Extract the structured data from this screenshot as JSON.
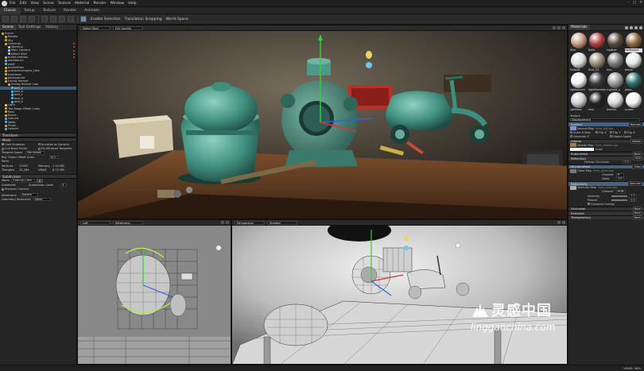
{
  "menubar": {
    "items": [
      "File",
      "Edit",
      "View",
      "Scene",
      "Texture",
      "Material",
      "Render",
      "Window",
      "Help"
    ]
  },
  "mode_tabs": [
    "Classic",
    "Setup",
    "Texture",
    "Render",
    "Animate"
  ],
  "toolbar": {
    "enable_selection": "Enable Selection",
    "translation_snapping": "Translation Snapping",
    "world_space": "World Space"
  },
  "left_panel": {
    "tabs": [
      "Scene",
      "Tool Settings",
      "History"
    ],
    "tree": [
      {
        "label": "Scene",
        "indent": 0,
        "icon": "scene"
      },
      {
        "label": "Render",
        "indent": 1,
        "icon": "folder"
      },
      {
        "label": "Sky",
        "indent": 1,
        "icon": "folder"
      },
      {
        "label": "Cameras",
        "indent": 1,
        "icon": "folder"
      },
      {
        "label": "Working",
        "indent": 2,
        "icon": "camera"
      },
      {
        "label": "Main Camera",
        "indent": 2,
        "icon": "camera"
      },
      {
        "label": "Detail Shot",
        "indent": 2,
        "icon": "camera"
      },
      {
        "label": "bullet prefabs",
        "indent": 1,
        "icon": "folder"
      },
      {
        "label": "workbench",
        "indent": 1,
        "icon": "mesh"
      },
      {
        "label": "shelf",
        "indent": 1,
        "icon": "mesh"
      },
      {
        "label": "bucketFiles",
        "indent": 1,
        "icon": "folder"
      },
      {
        "label": "screwdrivemptor_tiles",
        "indent": 1,
        "icon": "folder"
      },
      {
        "label": "toolcases",
        "indent": 1,
        "icon": "folder"
      },
      {
        "label": "background",
        "indent": 1,
        "icon": "folder"
      },
      {
        "label": "Diving Helmet",
        "indent": 1,
        "icon": "folder"
      },
      {
        "label": "Diving Helmet Low",
        "indent": 2,
        "icon": "folder"
      },
      {
        "label": "bolt_a",
        "indent": 3,
        "icon": "mesh"
      },
      {
        "label": "bolt_b",
        "indent": 3,
        "icon": "mesh"
      },
      {
        "label": "bolt_c",
        "indent": 3,
        "icon": "mesh"
      },
      {
        "label": "bolt_d",
        "indent": 3,
        "icon": "mesh"
      },
      {
        "label": "bolt_e",
        "indent": 3,
        "icon": "mesh"
      },
      {
        "label": "Light",
        "indent": 1,
        "icon": "light"
      },
      {
        "label": "Top Stage Offset Lines",
        "indent": 1,
        "icon": "folder"
      },
      {
        "label": "Rear",
        "indent": 1,
        "icon": "folder"
      },
      {
        "label": "Boxes",
        "indent": 1,
        "icon": "folder"
      },
      {
        "label": "Ground",
        "indent": 1,
        "icon": "mesh"
      },
      {
        "label": "Walls",
        "indent": 1,
        "icon": "mesh"
      },
      {
        "label": "Props",
        "indent": 1,
        "icon": "folder"
      },
      {
        "label": "Helmet",
        "indent": 1,
        "icon": "mesh"
      }
    ],
    "transform_section": "Transform",
    "mesh_section": "Mesh",
    "cast_shadows": "Cast Shadows",
    "invisible_to_camera": "Invisible to Camera",
    "cull_back_faces": "Cull Back Faces",
    "fix_mirrored_tangents": "Fix Mirrored Tangents",
    "tangent_space": "Tangent Space",
    "tangent_space_value": "Marmoset",
    "ray_origin_offset": "Ray Origin Offset (mm)",
    "ray_origin_value": "0.0",
    "parts_label": "Parts",
    "vertices_label": "Vertices",
    "vertices_value": "12597",
    "triangles_label": "Triangles",
    "triangles_value": "22,269",
    "memory_label": "Memory",
    "memory_value": "1.34 MB",
    "vram_label": "VRAM",
    "vram_value": "8.72 MB",
    "subdivision_section": "Subdivision",
    "mode_label": "Mode",
    "mode_value": "Catmull-Clark",
    "subdivide_label": "Subdivide",
    "subdivision_level_label": "Subdivision Level",
    "subdivision_level_value": "3",
    "sharpen_corners": "Sharpen Corners",
    "wireframe_label": "Wireframe",
    "wireframe_value": "Isolate",
    "geometry_reduction_label": "Geometry Reduction",
    "geometry_reduction_value": "None"
  },
  "viewports": {
    "main": {
      "camera": "Detail Shot",
      "quality": "Full Quality"
    },
    "left": {
      "camera": "Left",
      "mode": "Wireframe"
    },
    "perspective": {
      "camera": "Perspective",
      "mode": "Shaded"
    }
  },
  "right_panel": {
    "title": "Materials",
    "materials": [
      {
        "name": "Skin",
        "color": "#c99c82",
        "selected": false
      },
      {
        "name": "Bolts",
        "color": "#b04040",
        "selected": false
      },
      {
        "name": "Leather",
        "color": "#5a4a3e",
        "selected": false
      },
      {
        "name": "cardboard",
        "color": "#8a6840",
        "selected": true
      },
      {
        "name": "Default",
        "color": "#dcdcdc",
        "selected": false
      },
      {
        "name": "Rust_02",
        "color": "#9a8b76",
        "selected": false
      },
      {
        "name": "Iron",
        "color": "#7a7a7a",
        "selected": false
      },
      {
        "name": "bottle",
        "color": "#e6e6e6",
        "selected": false
      },
      {
        "name": "lightsource",
        "color": "#f2f2f2",
        "selected": false
      },
      {
        "name": "lightBrackets",
        "color": "#3a3a3a",
        "selected": false
      },
      {
        "name": "rustbolt_a",
        "color": "#9a9a9a",
        "selected": false
      },
      {
        "name": "glass",
        "color": "#2e6e6a",
        "selected": false
      },
      {
        "name": "lightface",
        "color": "#cfcfcf",
        "selected": false
      },
      {
        "name": "lens",
        "color": "#222222",
        "selected": false
      },
      {
        "name": "helmet",
        "color": "#d8d8d8",
        "selected": false
      },
      {
        "name": "screen",
        "color": "#f2f2f2",
        "selected": false
      }
    ],
    "texture_label": "Texture",
    "displacement_value": "Displacement",
    "surface_section": "Surface",
    "surface_tag": "Normals",
    "normal_map_label": "Normal Map",
    "normal_map_file": "lines_adj.tga",
    "scale_bias": "Scale & Bias",
    "flip_x": "Flip X",
    "flip_y": "Flip Y",
    "flip_z": "Flip Z",
    "generate_z": "Generate Z",
    "object_space": "Object Space",
    "albedo_section": "Albedo",
    "albedo_tag": "Albedo",
    "albedo_map_label": "Albedo Map",
    "albedo_map_file": "lines_albedo.tga",
    "color_label": "Color",
    "subsurface_section": "Subsurface",
    "subsurface_tag": "None",
    "microsurface_section": "Microsurface",
    "microsurface_tag": "Gloss",
    "gloss_map_label": "Gloss Map",
    "gloss_map_file": "lines_gloss.tga",
    "channel_label": "Channel",
    "channel_value": "R",
    "gloss_label": "Gloss",
    "gloss_value": "1.0",
    "reflection_section": "Reflection",
    "reflection_tag": "GGX",
    "reflectivity_section": "Reflectivity",
    "reflectivity_tag": "Specular",
    "horizon_occlusion_label": "Horizon Occlusion",
    "horizon_occlusion_value": "1.0",
    "specular_map_label": "Specular Map",
    "specular_map_file": "lines_spec.tga",
    "channel_value_rgb": "RGB",
    "intensity_label": "Intensity",
    "intensity_value": "1.0",
    "fresnel_label": "Fresnel",
    "fresnel_value": "1.0",
    "conserve_energy": "Conserve Energy",
    "occlusion_section": "Occlusion",
    "occlusion_tag": "None",
    "emissive_section": "Emissive",
    "emissive_tag": "None",
    "transparency_section": "Transparency",
    "transparency_tag": "None"
  },
  "status_bar": {
    "vram": "VRAM: 46%"
  },
  "watermark": {
    "logo_text": "灵感中国",
    "url_text": "lingganchina.com"
  },
  "colors": {
    "accent_selection": "#3c5a74",
    "gizmo_x": "#e03030",
    "gizmo_y": "#30d040",
    "gizmo_z": "#3060e0",
    "teal_paint": "#3f8f7f"
  }
}
